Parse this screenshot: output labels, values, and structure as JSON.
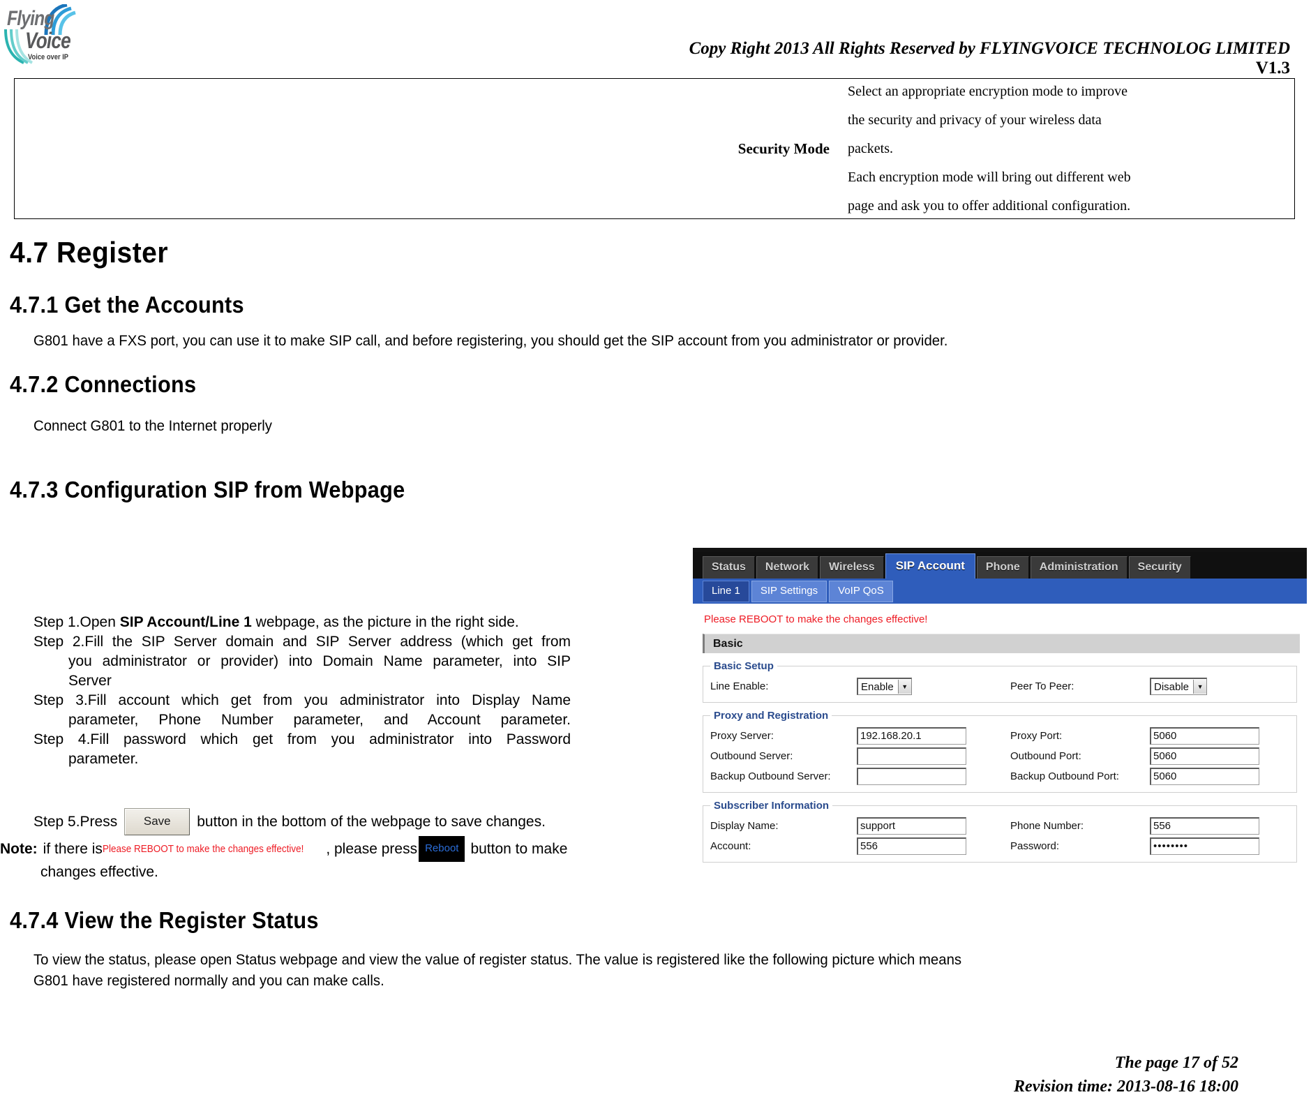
{
  "header": {
    "logo": {
      "flying": "Flying",
      "voice": "Voice",
      "tagline": "Voice over IP"
    },
    "copyright": "Copy Right 2013 All Rights Reserved by FLYINGVOICE TECHNOLOG LIMITED",
    "version": "V1.3"
  },
  "param_table": {
    "label": "Security Mode",
    "description": "Select an appropriate encryption mode to improve the security and privacy of your wireless data packets. Each encryption mode will bring out different web page and ask you to offer additional configuration.",
    "description_lines": [
      "Select an appropriate encryption mode to improve",
      "the security and privacy of your wireless data",
      "packets.",
      "Each encryption mode will bring out different web",
      "page and ask you to offer additional configuration."
    ]
  },
  "sections": {
    "s47_title": "4.7  Register",
    "s471_title": "4.7.1  Get the Accounts",
    "s471_body": "G801 have a FXS port, you can use it to make SIP call, and before registering, you should get the SIP account from you administrator or provider.",
    "s472_title": "4.7.2 Connections",
    "s472_body": "Connect G801 to the Internet properly",
    "s473_title": "4.7.3  Configuration SIP from Webpage",
    "s474_title": "4.7.4  View the Register Status",
    "s474_body_line1": "To view the status, please open Status webpage and view the value of register status. The value is registered like the following picture which means",
    "s474_body_line2": "G801 have registered normally and you can make calls."
  },
  "steps": {
    "step1_a": "Step 1.Open ",
    "step1_b": "SIP Account/Line 1",
    "step1_c": " webpage, as the picture in the right side.",
    "step2_l1": "Step 2.Fill the SIP Server domain and SIP Server address (which get from",
    "step2_l2": "you administrator or provider) into Domain Name parameter, into SIP",
    "step2_l3": "Server",
    "step3_l1": "Step 3.Fill account which get from you administrator into Display Name",
    "step3_l2": "parameter, Phone Number parameter, and Account parameter.",
    "step4_l1": "Step 4.Fill password which get from you administrator into Password",
    "step4_l2": "parameter.",
    "step5_a": "Step 5.Press",
    "step5_save_button": "Save",
    "step5_b": "button in the bottom of the webpage to save changes."
  },
  "note": {
    "label": "Note:",
    "text_a": "if there is",
    "red_text": "Please REBOOT to make the changes effective!",
    "text_b": ", please press",
    "reboot_button": "Reboot",
    "text_c": "button to make",
    "line2": "changes effective."
  },
  "footer": {
    "page": "The page 17 of 52",
    "revision": "Revision time: 2013-08-16 18:00"
  },
  "webui": {
    "nav_tabs": [
      "Status",
      "Network",
      "Wireless",
      "SIP Account",
      "Phone",
      "Administration",
      "Security"
    ],
    "nav_active": "SIP Account",
    "sub_tabs": [
      "Line 1",
      "SIP Settings",
      "VoIP QoS"
    ],
    "sub_active": "Line 1",
    "reboot_notice": "Please REBOOT to make the changes effective!",
    "panel_title": "Basic",
    "groups": {
      "basic_setup": {
        "legend": "Basic Setup",
        "fields": [
          {
            "label": "Line Enable:",
            "type": "select",
            "value": "Enable"
          },
          {
            "label": "Peer To Peer:",
            "type": "select",
            "value": "Disable"
          }
        ]
      },
      "proxy_registration": {
        "legend": "Proxy and Registration",
        "rows": [
          {
            "l_label": "Proxy Server:",
            "l_value": "192.168.20.1",
            "r_label": "Proxy Port:",
            "r_value": "5060"
          },
          {
            "l_label": "Outbound Server:",
            "l_value": "",
            "r_label": "Outbound Port:",
            "r_value": "5060"
          },
          {
            "l_label": "Backup Outbound Server:",
            "l_value": "",
            "r_label": "Backup Outbound Port:",
            "r_value": "5060"
          }
        ]
      },
      "subscriber_information": {
        "legend": "Subscriber Information",
        "rows": [
          {
            "l_label": "Display Name:",
            "l_value": "support",
            "r_label": "Phone Number:",
            "r_value": "556"
          },
          {
            "l_label": "Account:",
            "l_value": "556",
            "r_label": "Password:",
            "r_value": "••••••••"
          }
        ]
      }
    },
    "colors": {
      "nav_bg": "#101010",
      "nav_active": "#2f5dbb",
      "subnav_bg": "#2f5dbb",
      "subtab_bg": "#5d84d6",
      "notice_red": "#ee1c25",
      "legend_blue": "#2a4b8d"
    }
  }
}
